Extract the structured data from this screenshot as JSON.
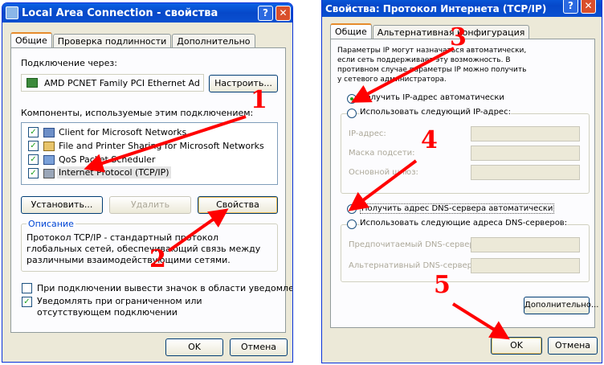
{
  "left_window": {
    "title": "Local Area Connection - свойства",
    "help_glyph": "?",
    "close_glyph": "✕",
    "tabs": [
      "Общие",
      "Проверка подлинности",
      "Дополнительно"
    ],
    "connect_using_label": "Подключение через:",
    "adapter_name": "AMD PCNET Family PCI Ethernet Ad",
    "configure_button": "Настроить...",
    "components_label": "Компоненты, используемые этим подключением:",
    "components": [
      {
        "label": "Client for Microsoft Networks",
        "checked": true
      },
      {
        "label": "File and Printer Sharing for Microsoft Networks",
        "checked": true
      },
      {
        "label": "QoS Packet Scheduler",
        "checked": true
      },
      {
        "label": "Internet Protocol (TCP/IP)",
        "checked": true
      }
    ],
    "install_button": "Установить...",
    "uninstall_button": "Удалить",
    "properties_button": "Свойства",
    "description_title": "Описание",
    "description_text": "Протокол TCP/IP - стандартный протокол глобальных сетей, обеспечивающий связь между различными взаимодействующими сетями.",
    "show_icon_label": "При подключении вывести значок в области уведомлений",
    "show_icon_checked": false,
    "notify_label": "Уведомлять при ограниченном или отсутствующем подключении",
    "notify_checked": true,
    "ok_button": "OK",
    "cancel_button": "Отмена"
  },
  "right_window": {
    "title": "Свойства: Протокол Интернета (TCP/IP)",
    "help_glyph": "?",
    "close_glyph": "✕",
    "tabs": [
      "Общие",
      "Альтернативная конфигурация"
    ],
    "info_text": "Параметры IP могут назначаться автоматически, если сеть поддерживает эту возможность. В противном случае параметры IP можно получить у сетевого администратора.",
    "radio_auto_ip": "Получить IP-адрес автоматически",
    "radio_auto_ip_selected": true,
    "radio_manual_ip": "Использовать следующий IP-адрес:",
    "ip_address_label": "IP-адрес:",
    "subnet_label": "Маска подсети:",
    "gateway_label": "Основной шлюз:",
    "radio_auto_dns": "Получить адрес DNS-сервера автоматически",
    "radio_auto_dns_selected": true,
    "radio_manual_dns": "Использовать следующие адреса DNS-серверов:",
    "preferred_dns_label": "Предпочитаемый DNS-сервер:",
    "alternate_dns_label": "Альтернативный DNS-сервер:",
    "advanced_button": "Дополнительно...",
    "ok_button": "OK",
    "cancel_button": "Отмена"
  },
  "annotations": [
    "1",
    "2",
    "3",
    "4",
    "5"
  ],
  "colors": {
    "arrow": "#ff0000",
    "title_bar": "#0a5fe0",
    "dialog_bg": "#ece9d8"
  }
}
